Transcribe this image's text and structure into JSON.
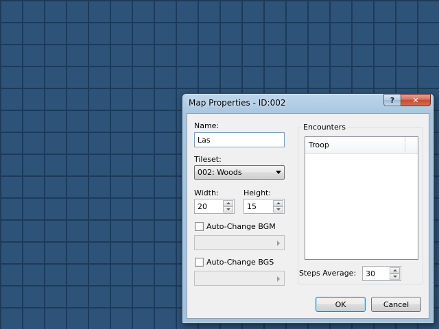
{
  "window": {
    "title": "Map Properties - ID:002",
    "help_label": "?",
    "close_label": "✕"
  },
  "form": {
    "name_label": "Name:",
    "name_value": "Las",
    "tileset_label": "Tileset:",
    "tileset_value": "002: Woods",
    "width_label": "Width:",
    "width_value": "20",
    "height_label": "Height:",
    "height_value": "15",
    "bgm_label": "Auto-Change BGM",
    "bgs_label": "Auto-Change BGS"
  },
  "encounters": {
    "group_label": "Encounters",
    "column_troop": "Troop",
    "steps_label": "Steps Average:",
    "steps_value": "30"
  },
  "buttons": {
    "ok_label": "OK",
    "cancel_label": "Cancel"
  },
  "colors": {
    "background_tile": "#2d5378",
    "grid_line": "#1e3a58",
    "dialog_frame": "#a9c6df",
    "client": "#f0f0f0"
  }
}
